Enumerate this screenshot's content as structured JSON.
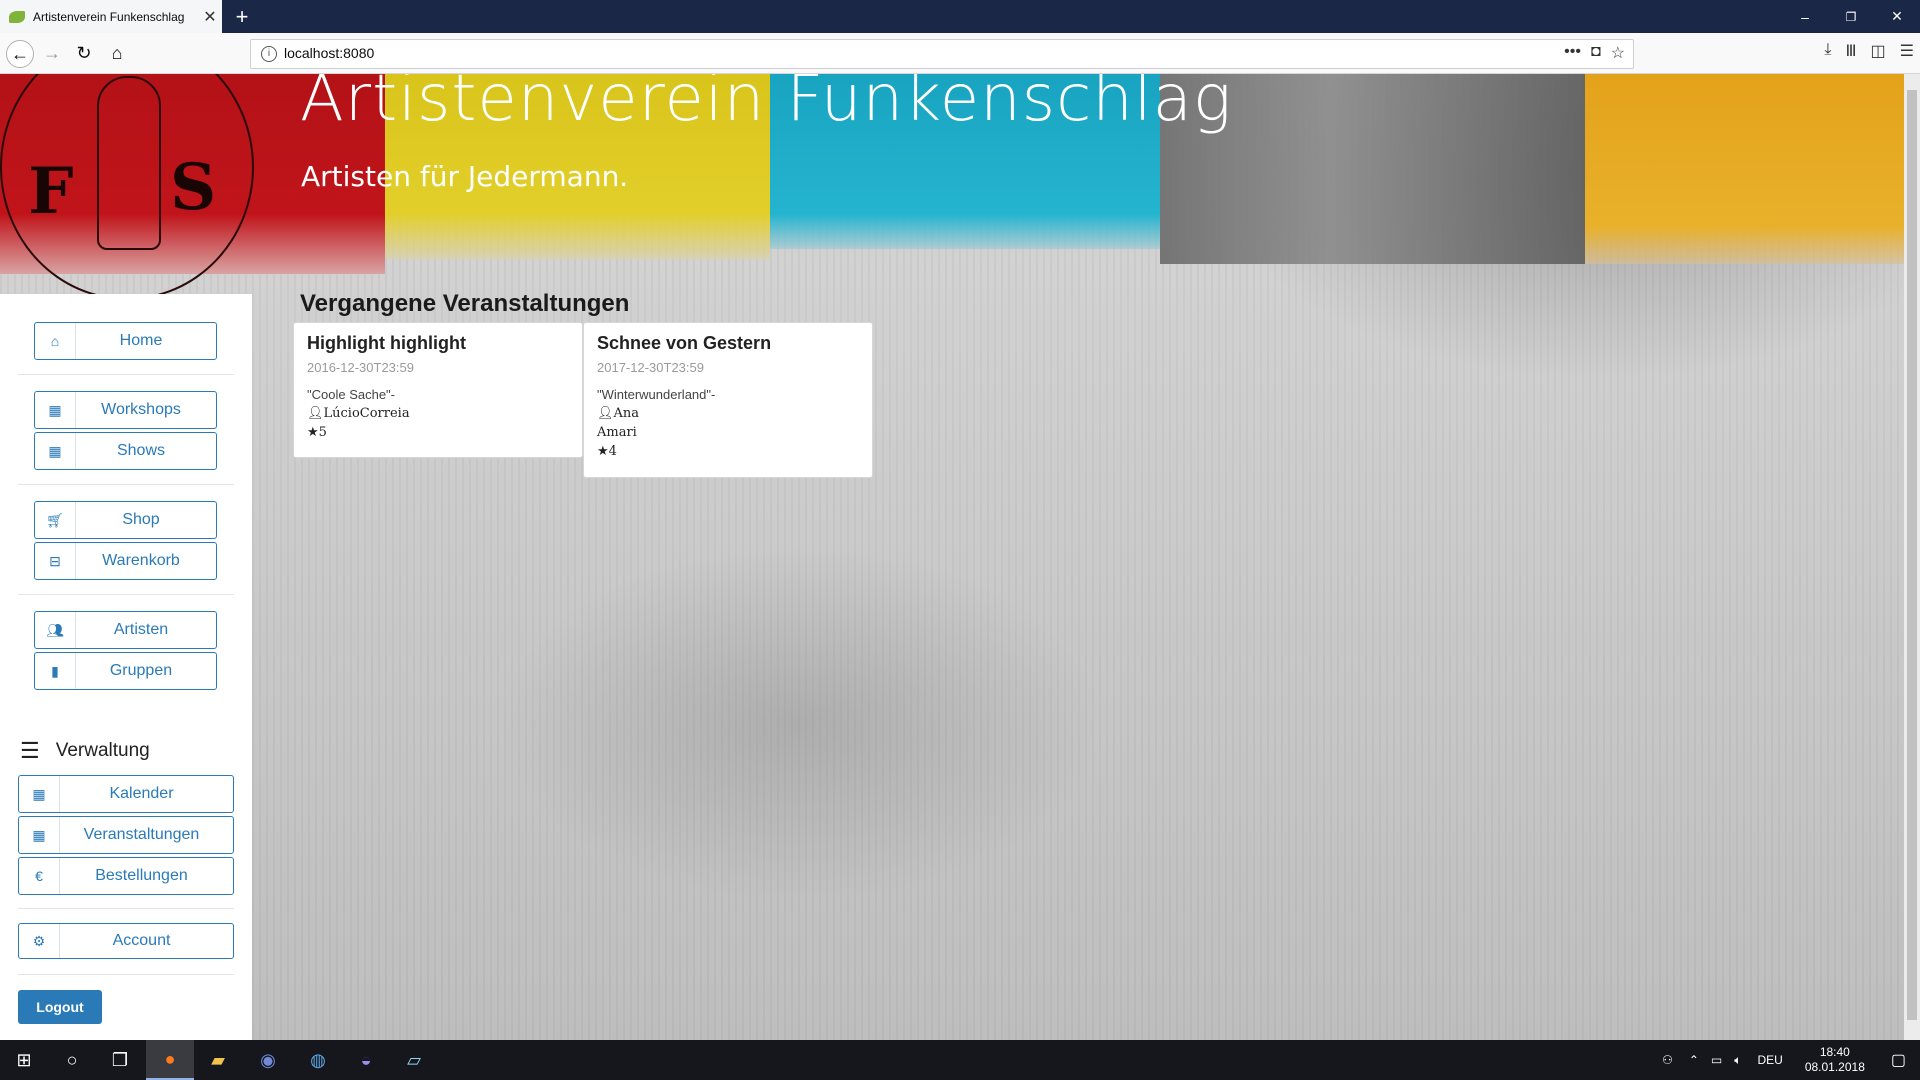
{
  "browser": {
    "tab_title": "Artistenverein Funkenschlag",
    "tab_close": "✕",
    "new_tab": "+",
    "url": "localhost:8080",
    "page_actions": "•••",
    "win_minimize": "–",
    "win_restore": "❐",
    "win_close": "✕"
  },
  "header": {
    "title": "Artistenverein Funkenschlag",
    "subtitle": "Artisten für Jedermann.",
    "emblem_letters": [
      "F",
      "S"
    ]
  },
  "sidebar": {
    "home": "Home",
    "workshops": "Workshops",
    "shows": "Shows",
    "shop": "Shop",
    "warenkorb": "Warenkorb",
    "artisten": "Artisten",
    "gruppen": "Gruppen",
    "verwaltung": "Verwaltung",
    "kalender": "Kalender",
    "veranstaltungen": "Veranstaltungen",
    "bestellungen": "Bestellungen",
    "account": "Account",
    "logout": "Logout",
    "accent_color": "#2a7ab8"
  },
  "main": {
    "section_title": "Vergangene Veranstaltungen",
    "cards": [
      {
        "title": "Highlight highlight",
        "date": "2016-12-30T23:59",
        "desc": "\"Coole Sache\"-",
        "person": "LúcioCorreia",
        "rating": "5"
      },
      {
        "title": "Schnee von Gestern",
        "date": "2017-12-30T23:59",
        "desc": "\"Winterwunderland\"-",
        "person": "Ana",
        "person2": "Amari",
        "rating": "4"
      }
    ]
  },
  "taskbar": {
    "lang": "DEU",
    "time": "18:40",
    "date": "08.01.2018"
  }
}
